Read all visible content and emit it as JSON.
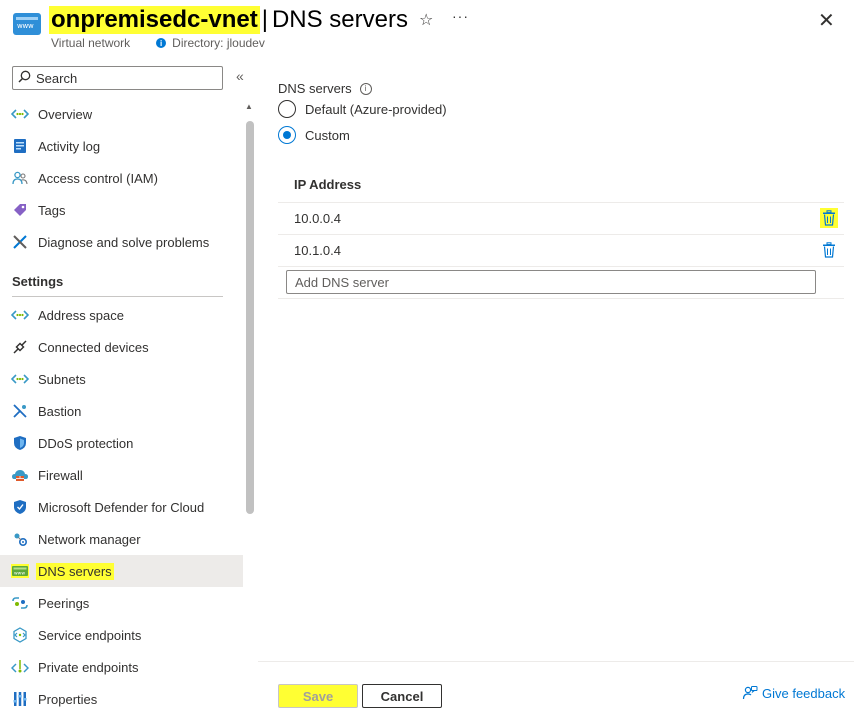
{
  "header": {
    "resource_icon_text": "www",
    "resource_name": "onpremisedc-vnet",
    "separator": "|",
    "page_title": "DNS servers",
    "resource_type": "Virtual network",
    "directory_label": "Directory: jloudev",
    "star_glyph": "☆",
    "more_glyph": "···",
    "close_glyph": "✕"
  },
  "sidebar": {
    "search_placeholder": "Search",
    "collapse_glyph": "«",
    "items_top": [
      {
        "label": "Overview",
        "icon": "vnet-arrows-icon"
      },
      {
        "label": "Activity log",
        "icon": "activity-log-icon"
      },
      {
        "label": "Access control (IAM)",
        "icon": "people-icon"
      },
      {
        "label": "Tags",
        "icon": "tag-icon"
      },
      {
        "label": "Diagnose and solve problems",
        "icon": "wrench-icon"
      }
    ],
    "settings_heading": "Settings",
    "items_settings": [
      {
        "label": "Address space",
        "icon": "vnet-arrows-icon"
      },
      {
        "label": "Connected devices",
        "icon": "plug-icon"
      },
      {
        "label": "Subnets",
        "icon": "vnet-arrows-icon"
      },
      {
        "label": "Bastion",
        "icon": "bastion-icon"
      },
      {
        "label": "DDoS protection",
        "icon": "shield-icon"
      },
      {
        "label": "Firewall",
        "icon": "firewall-icon"
      },
      {
        "label": "Microsoft Defender for Cloud",
        "icon": "defender-shield-icon"
      },
      {
        "label": "Network manager",
        "icon": "network-manager-icon"
      },
      {
        "label": "DNS servers",
        "icon": "dns-server-icon",
        "selected": true
      },
      {
        "label": "Peerings",
        "icon": "peering-icon"
      },
      {
        "label": "Service endpoints",
        "icon": "service-endpoint-icon"
      },
      {
        "label": "Private endpoints",
        "icon": "private-endpoint-icon"
      },
      {
        "label": "Properties",
        "icon": "properties-icon"
      }
    ]
  },
  "main": {
    "dns_servers_label": "DNS servers",
    "info_glyph": "i",
    "options": [
      {
        "label": "Default (Azure-provided)",
        "checked": false
      },
      {
        "label": "Custom",
        "checked": true
      }
    ],
    "table_header": "IP Address",
    "rows": [
      {
        "ip": "10.0.0.4"
      },
      {
        "ip": "10.1.0.4"
      }
    ],
    "add_placeholder": "Add DNS server"
  },
  "footer": {
    "save_label": "Save",
    "cancel_label": "Cancel",
    "feedback_label": "Give feedback"
  },
  "colors": {
    "accent": "#0078d4",
    "highlight": "#ffff33",
    "selected_bg": "#edebe9"
  }
}
